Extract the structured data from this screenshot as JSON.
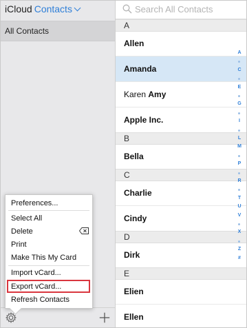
{
  "app": {
    "brand": "iCloud",
    "section": "Contacts"
  },
  "sidebar": {
    "group": "All Contacts"
  },
  "menu": {
    "items": [
      "Preferences...",
      "Select All",
      "Delete",
      "Print",
      "Make This My Card",
      "Import vCard...",
      "Export vCard...",
      "Refresh Contacts"
    ],
    "highlighted": "Export vCard..."
  },
  "search": {
    "placeholder": "Search All Contacts",
    "value": ""
  },
  "contacts": {
    "sections": [
      {
        "letter": "A",
        "rows": [
          {
            "first": "",
            "last": "Allen",
            "selected": false
          },
          {
            "first": "",
            "last": "Amanda",
            "selected": true
          },
          {
            "first": "Karen",
            "last": "Amy",
            "selected": false
          },
          {
            "first": "",
            "last": "Apple Inc.",
            "selected": false
          }
        ]
      },
      {
        "letter": "B",
        "rows": [
          {
            "first": "",
            "last": "Bella",
            "selected": false
          }
        ]
      },
      {
        "letter": "C",
        "rows": [
          {
            "first": "",
            "last": "Charlie",
            "selected": false
          },
          {
            "first": "",
            "last": "Cindy",
            "selected": false
          }
        ]
      },
      {
        "letter": "D",
        "rows": [
          {
            "first": "",
            "last": "Dirk",
            "selected": false
          }
        ]
      },
      {
        "letter": "E",
        "rows": [
          {
            "first": "",
            "last": "Elien",
            "selected": false
          },
          {
            "first": "",
            "last": "Ellen",
            "selected": false
          }
        ]
      }
    ]
  },
  "index": [
    "A",
    "•",
    "C",
    "•",
    "E",
    "•",
    "G",
    "•",
    "I",
    "•",
    "L",
    "M",
    "•",
    "P",
    "•",
    "R",
    "•",
    "T",
    "U",
    "V",
    "•",
    "X",
    "•",
    "Z",
    "#"
  ],
  "colors": {
    "accent": "#2f7fd8",
    "selected_row": "#d6e7f6",
    "highlight_border": "#d9363e"
  },
  "icons": {
    "settings": "gear-icon",
    "add": "plus-icon",
    "search": "search-icon",
    "delete_key": "delete-key-icon"
  }
}
